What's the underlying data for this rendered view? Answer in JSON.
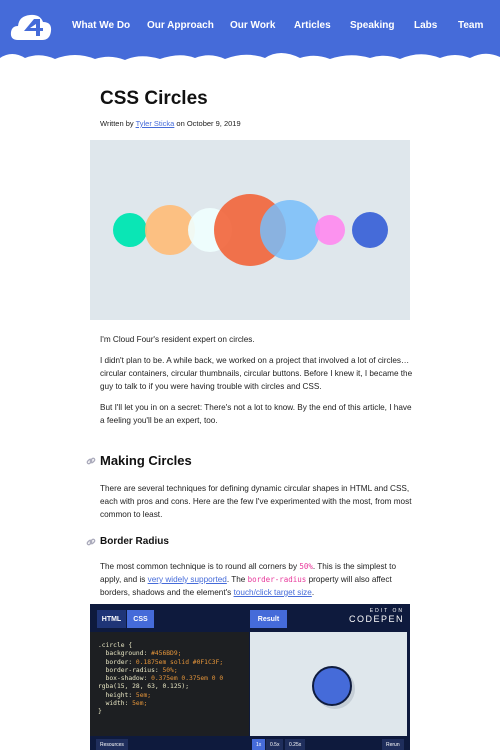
{
  "nav": {
    "items": [
      "What We Do",
      "Our Approach",
      "Our Work",
      "Articles",
      "Speaking",
      "Labs",
      "Team"
    ]
  },
  "brand": {
    "logo": "Cloud Four",
    "color": "#456bd9"
  },
  "article": {
    "title": "CSS Circles",
    "byline_prefix": "Written by ",
    "author": "Tyler Sticka",
    "byline_suffix": " on October 9, 2019",
    "hero_colors": [
      "#0ae6b5",
      "#ffbb77",
      "#efffff",
      "#f2643a",
      "#78bdfa",
      "#ff88f0",
      "#456bd9"
    ],
    "p1": "I'm Cloud Four's resident expert on circles.",
    "p2": "I didn't plan to be. A while back, we worked on a project that involved a lot of circles… circular containers, circular thumbnails, circular buttons. Before I knew it, I became the guy to talk to if you were having trouble with circles and CSS.",
    "p3": "But I'll let you in on a secret: There's not a lot to know. By the end of this article, I have a feeling you'll be an expert, too.",
    "h2": "Making Circles",
    "p4": "There are several techniques for defining dynamic circular shapes in HTML and CSS, each with pros and cons. Here are the few I've experimented with the most, from most common to least.",
    "h3": "Border Radius",
    "p5a": "The most common technique is to round all corners by ",
    "p5code1": "50%",
    "p5b": ". This is the simplest to apply, and is ",
    "p5link1": "very widely supported",
    "p5c": ". The ",
    "p5code2": "border-radius",
    "p5d": " property will also affect borders, shadows and the element's ",
    "p5link2": "touch/click target size",
    "p5e": "."
  },
  "codepen": {
    "tabs": [
      "HTML",
      "CSS"
    ],
    "result": "Result",
    "edit_on": "EDIT ON",
    "brand": "CODEPEN",
    "code": [
      [
        ".circle {",
        ""
      ],
      [
        "  background: ",
        "#456BD9;"
      ],
      [
        "  border: ",
        "0.1875em solid #0F1C3F;"
      ],
      [
        "  border-radius: ",
        "50%;"
      ],
      [
        "  box-shadow: ",
        "0.375em 0.375em 0 0"
      ],
      [
        "rgba(15, 28, 63, 0.125);",
        ""
      ],
      [
        "  height: ",
        "5em;"
      ],
      [
        "  width: ",
        "5em;"
      ],
      [
        "}",
        ""
      ]
    ],
    "resources": "Resources",
    "zoom": [
      "1x",
      "0.5x",
      "0.25x"
    ],
    "rerun": "Rerun"
  }
}
